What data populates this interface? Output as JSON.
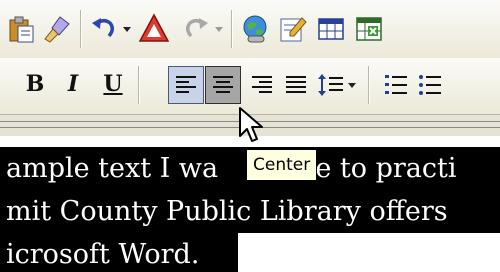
{
  "toolbar_standard": {
    "buttons": [
      {
        "icon": "paste-icon"
      },
      {
        "icon": "format-painter-icon"
      },
      {
        "icon": "undo-icon"
      },
      {
        "icon": "undo-dropdown-icon"
      },
      {
        "icon": "insert-shape-icon"
      },
      {
        "icon": "redo-icon"
      },
      {
        "icon": "redo-dropdown-icon"
      },
      {
        "icon": "hyperlink-icon"
      },
      {
        "icon": "drawing-tools-icon"
      },
      {
        "icon": "insert-table-icon"
      },
      {
        "icon": "insert-spreadsheet-icon"
      }
    ]
  },
  "toolbar_formatting": {
    "bold_label": "B",
    "italic_label": "I",
    "underline_label": "U",
    "align_left_state": "checked",
    "align_center_state": "pressed"
  },
  "tooltip": {
    "text": "Center"
  },
  "document": {
    "lines": [
      {
        "before": "ample text I wa",
        "after": "use to practi"
      },
      {
        "text": "mit County Public Library offers"
      },
      {
        "text": "icrosoft Word."
      }
    ]
  },
  "colors": {
    "toolbar_top": "#fbfbf8",
    "toolbar_bottom": "#ece9d8",
    "selection_bg": "#000000",
    "selection_text": "#ffffff",
    "tooltip_bg": "#ffffe1",
    "align_checked_bg": "#c9d3e8",
    "align_pressed_bg": "#a6a6a6"
  }
}
